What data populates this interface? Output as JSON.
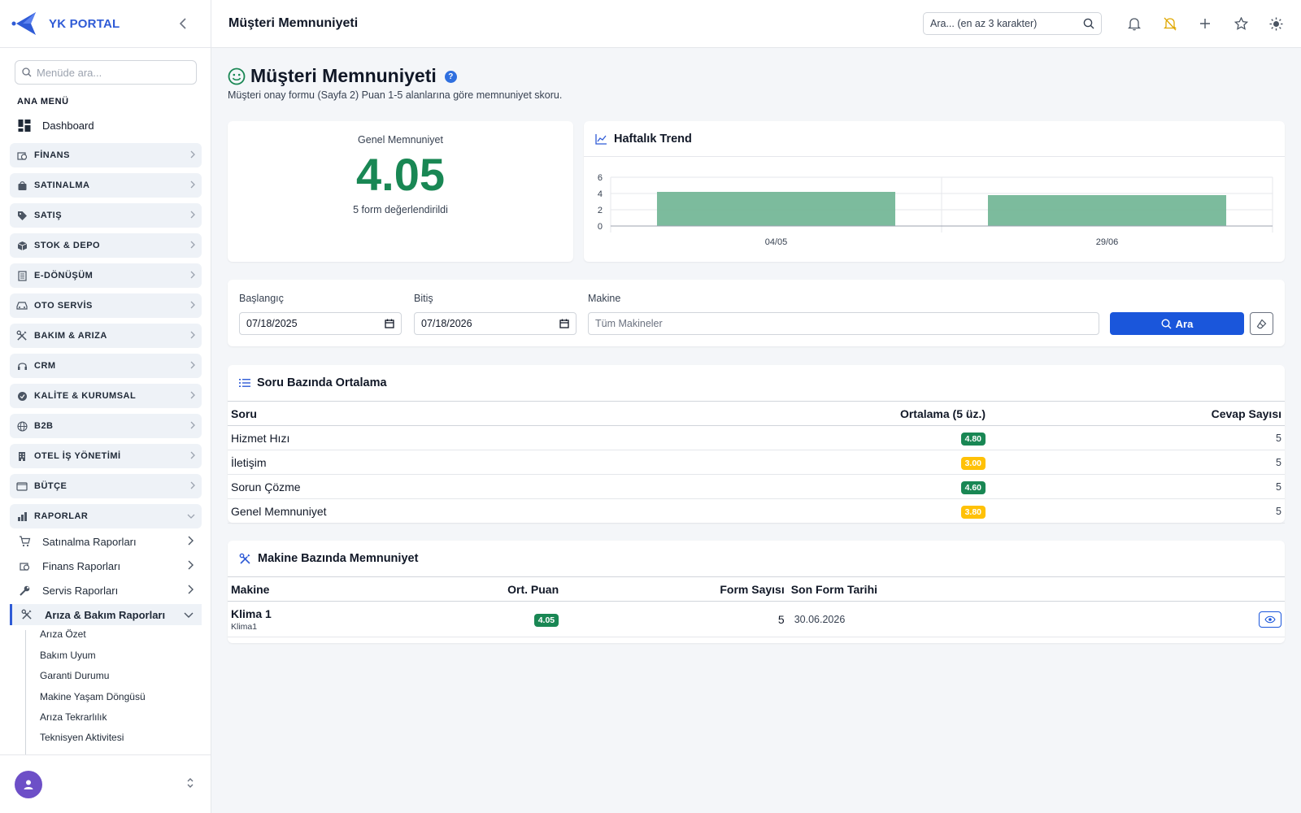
{
  "sidebar": {
    "brand": "YK PORTAL",
    "search_placeholder": "Menüde ara...",
    "menu_heading": "ANA MENÜ",
    "dashboard": "Dashboard",
    "groups": [
      {
        "label": "FİNANS",
        "icon": "finance-icon"
      },
      {
        "label": "SATINALMA",
        "icon": "bag-icon"
      },
      {
        "label": "SATIŞ",
        "icon": "tag-icon"
      },
      {
        "label": "STOK & DEPO",
        "icon": "box-icon"
      },
      {
        "label": "E-DÖNÜŞÜM",
        "icon": "document-icon"
      },
      {
        "label": "OTO SERVİS",
        "icon": "car-icon"
      },
      {
        "label": "BAKIM & ARIZA",
        "icon": "tools-icon"
      },
      {
        "label": "CRM",
        "icon": "headset-icon"
      },
      {
        "label": "KALİTE & KURUMSAL",
        "icon": "patch-check-icon"
      },
      {
        "label": "B2B",
        "icon": "globe-icon"
      },
      {
        "label": "OTEL İŞ YÖNETİMİ",
        "icon": "building-icon"
      },
      {
        "label": "BÜTÇE",
        "icon": "wallet-icon"
      },
      {
        "label": "RAPORLAR",
        "icon": "bar-chart-icon"
      }
    ],
    "report_items": [
      {
        "label": "Satınalma Raporları",
        "icon": "cart-icon"
      },
      {
        "label": "Finans Raporları",
        "icon": "finance-icon"
      },
      {
        "label": "Servis Raporları",
        "icon": "wrench-icon"
      },
      {
        "label": "Arıza & Bakım Raporları",
        "icon": "tools-icon"
      }
    ],
    "leaves": [
      "Arıza Özet",
      "Bakım Uyum",
      "Garanti Durumu",
      "Makine Yaşam Döngüsü",
      "Arıza Tekrarlılık",
      "Teknisyen Aktivitesi"
    ]
  },
  "topbar": {
    "title": "Müşteri Memnuniyeti",
    "search_placeholder": "Ara... (en az 3 karakter)"
  },
  "page": {
    "title": "Müşteri Memnuniyeti",
    "help": "?",
    "subtitle": "Müşteri onay formu (Sayfa 2) Puan 1-5 alanlarına göre memnuniyet skoru."
  },
  "score": {
    "label": "Genel Memnuniyet",
    "value": "4.05",
    "count": "5 form değerlendirildi"
  },
  "trend": {
    "title": "Haftalık Trend"
  },
  "chart_data": {
    "type": "bar",
    "categories": [
      "04/05",
      "29/06"
    ],
    "values": [
      4.2,
      3.8
    ],
    "ylim": [
      0,
      6
    ],
    "yticks": [
      "0",
      "2",
      "4",
      "6"
    ],
    "color": "#75b798",
    "grid": true
  },
  "filters": {
    "start_label": "Başlangıç",
    "start_value": "07/18/2025",
    "end_label": "Bitiş",
    "end_value": "07/18/2026",
    "machine_label": "Makine",
    "machine_placeholder": "Tüm Makineler",
    "search_button": "Ara"
  },
  "questions": {
    "title": "Soru Bazında Ortalama",
    "headers": [
      "Soru",
      "Ortalama (5 üz.)",
      "Cevap Sayısı"
    ],
    "rows": [
      {
        "question": "Hizmet Hızı",
        "avg": "4.80",
        "level": "green",
        "count": "5"
      },
      {
        "question": "İletişim",
        "avg": "3.00",
        "level": "yellow",
        "count": "5"
      },
      {
        "question": "Sorun Çözme",
        "avg": "4.60",
        "level": "green",
        "count": "5"
      },
      {
        "question": "Genel Memnuniyet",
        "avg": "3.80",
        "level": "yellow",
        "count": "5"
      }
    ]
  },
  "machines": {
    "title": "Makine Bazında Memnuniyet",
    "headers": [
      "Makine",
      "Ort. Puan",
      "Form Sayısı",
      "Son Form Tarihi"
    ],
    "rows": [
      {
        "name": "Klima 1",
        "code": "Klima1",
        "score": "4.05",
        "forms": "5",
        "last_date": "30.06.2026"
      }
    ]
  },
  "colors": {
    "accent": "#1a56db",
    "success": "#198754",
    "warning": "#ffc107",
    "brand": "#2f5bd6"
  }
}
